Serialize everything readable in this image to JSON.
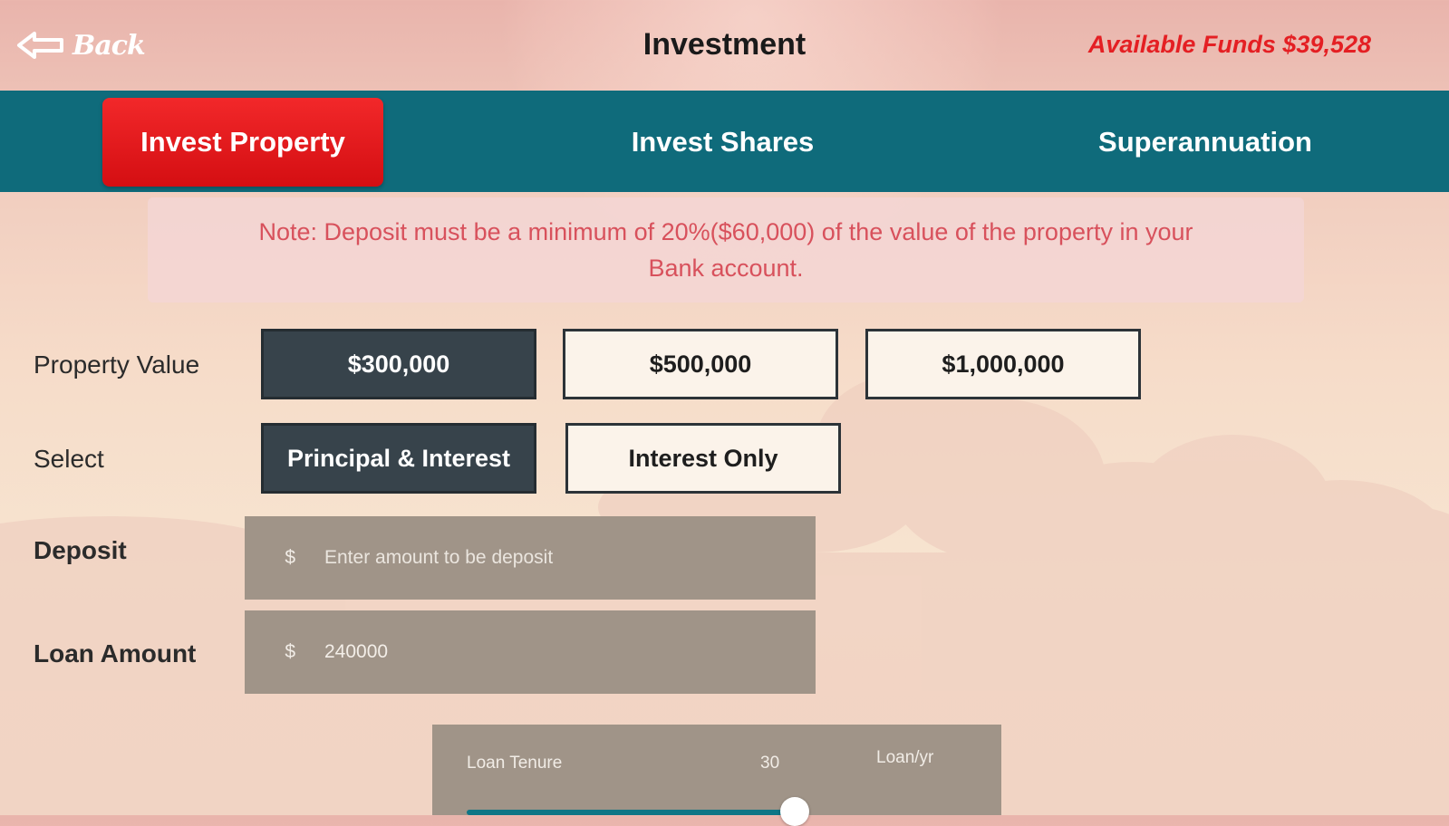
{
  "header": {
    "back_label": "Back",
    "title": "Investment",
    "available_funds": "Available Funds $39,528"
  },
  "tabs": [
    {
      "label": "Invest Property",
      "active": true
    },
    {
      "label": "Invest Shares",
      "active": false
    },
    {
      "label": "Superannuation",
      "active": false
    }
  ],
  "note": {
    "line1": "Note: Deposit must be a minimum of 20%($60,000) of the value of the property in your",
    "line2": "Bank account."
  },
  "property_value": {
    "label": "Property Value",
    "options": [
      "$300,000",
      "$500,000",
      "$1,000,000"
    ],
    "selected": "$300,000"
  },
  "loan_type": {
    "label": "Select",
    "options": [
      "Principal & Interest",
      "Interest Only"
    ],
    "selected": "Principal & Interest"
  },
  "deposit": {
    "label": "Deposit",
    "currency": "$",
    "placeholder": "Enter amount to be deposit",
    "value": ""
  },
  "loan_amount": {
    "label": "Loan Amount",
    "currency": "$",
    "value": "240000"
  },
  "loan_tenure": {
    "label": "Loan Tenure",
    "value": "30",
    "unit_label": "Loan/yr",
    "slider_fraction": 0.9
  },
  "colors": {
    "tab_bar": "#0f6b7b",
    "active_tab": "#e0181b",
    "selected_option": "#37434b",
    "funds_text": "#e41f23",
    "note_text": "#d8515c",
    "field_bg": "#a09488"
  }
}
